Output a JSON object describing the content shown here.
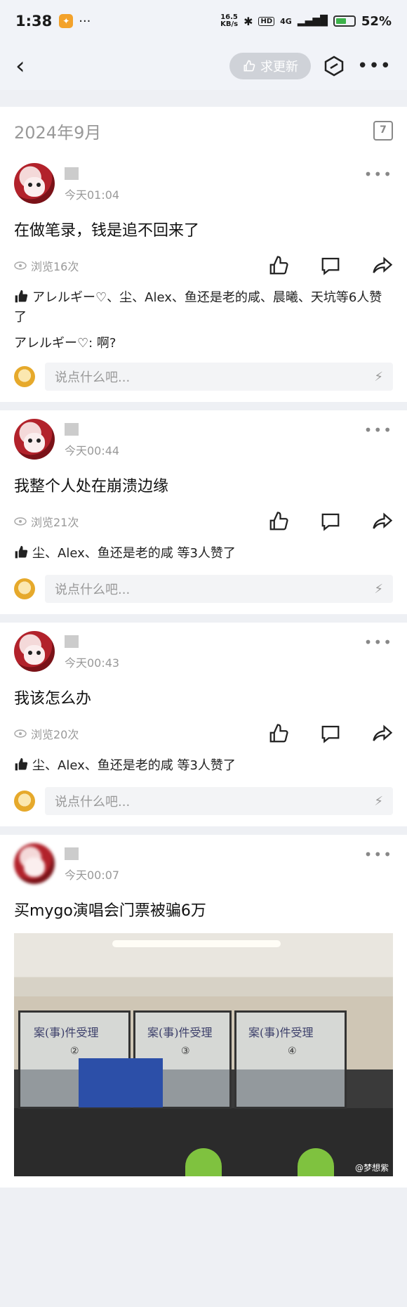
{
  "status_bar": {
    "time": "1:38",
    "more": "···",
    "net_speed": "16.5",
    "net_unit": "KB/s",
    "hd": "HD",
    "network": "4G",
    "battery": "52%"
  },
  "nav": {
    "back": "‹",
    "request_update": "求更新",
    "more": "•••"
  },
  "date_header": {
    "date": "2024年9月",
    "calendar_day": "7"
  },
  "posts": [
    {
      "time": "今天01:04",
      "text": "在做笔录，钱是追不回来了",
      "views": "浏览16次",
      "likes": "アレルギー♡、尘、Alex、鱼还是老的咸、晨曦、天坑等6人赞了",
      "reply_user": "アレルギー♡",
      "reply_text": ": 啊?",
      "comment_placeholder": "说点什么吧..."
    },
    {
      "time": "今天00:44",
      "text": "我整个人处在崩溃边缘",
      "views": "浏览21次",
      "likes": "尘、Alex、鱼还是老的咸 等3人赞了",
      "comment_placeholder": "说点什么吧..."
    },
    {
      "time": "今天00:43",
      "text": "我该怎么办",
      "views": "浏览20次",
      "likes": "尘、Alex、鱼还是老的咸 等3人赞了",
      "comment_placeholder": "说点什么吧..."
    },
    {
      "time": "今天00:07",
      "text": "买mygo演唱会门票被骗6万",
      "photo": {
        "sign1": "案(事)件受理",
        "sign2": "案(事)件受理",
        "sign3": "案(事)件受理",
        "n2": "②",
        "n3": "③",
        "n4": "④",
        "watermark": "@梦想紫"
      }
    }
  ]
}
